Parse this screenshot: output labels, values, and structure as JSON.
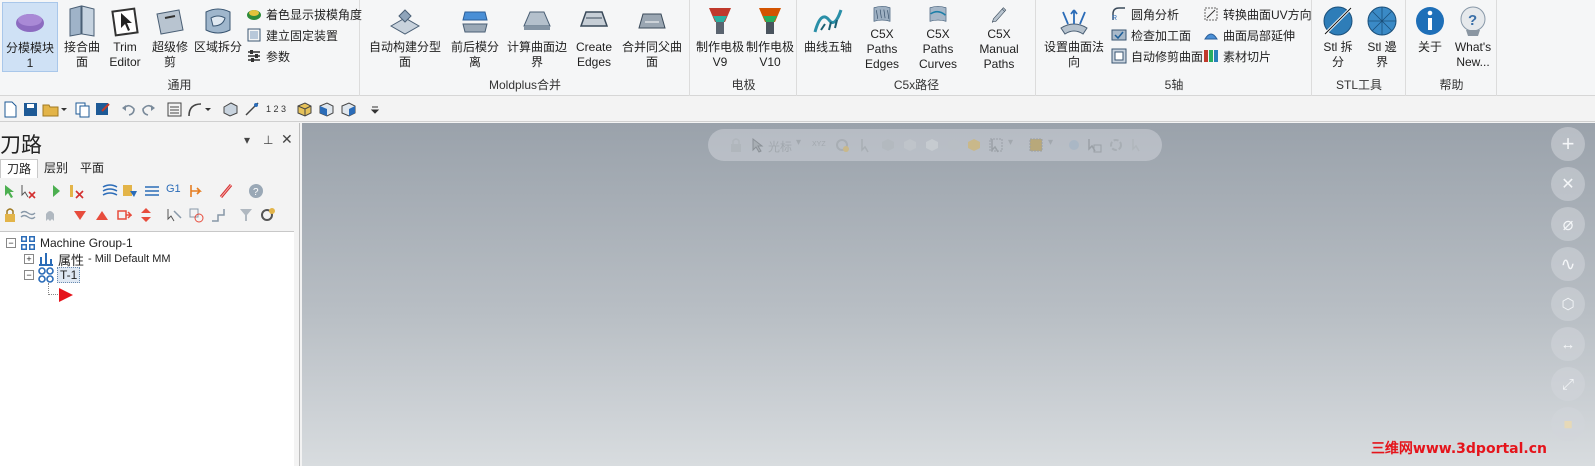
{
  "ribbon": {
    "general": {
      "label": "通用",
      "mold_split_label": "分模模块1",
      "join_surfaces_label": "接合曲面",
      "trim_editor_label": "Trim Editor",
      "super_trim_label": "超级修剪",
      "region_split_label": "区域拆分",
      "color_draft_label": "着色显示拔模角度",
      "fixture_label": "建立固定装置",
      "params_label": "参数"
    },
    "moldplus": {
      "label": "Moldplus合并",
      "auto_parting_label": "自动构建分型面",
      "front_back_split_label": "前后模分离",
      "calc_boundary_label": "计算曲面边界",
      "create_edges_label": "Create Edges",
      "merge_parent_label": "合并同父曲面"
    },
    "electrode": {
      "label": "电极",
      "electrode_v9_label": "制作电极 V9",
      "electrode_v10_label": "制作电极 V10"
    },
    "c5x": {
      "label": "C5x路径",
      "curve_5axis_label": "曲线五轴",
      "paths_edges_label": "C5X Paths Edges",
      "paths_curves_label": "C5X Paths Curves",
      "manual_paths_label": "C5X Manual Paths"
    },
    "five_axis": {
      "label": "5轴",
      "set_normal_label": "设置曲面法向",
      "fillet_analysis_label": "圆角分析",
      "check_machining_label": "检查加工面",
      "auto_trim_label": "自动修剪曲面",
      "convert_uv_label": "转换曲面UV方向",
      "local_extend_label": "曲面局部延伸",
      "material_slice_label": "素材切片"
    },
    "stl": {
      "label": "STL工具",
      "stl_split_label": "Stl 拆分",
      "stl_boundary_label": "Stl 邊界"
    },
    "help": {
      "label": "帮助",
      "about_label": "关于",
      "whats_new_label": "What's New..."
    }
  },
  "qat": {
    "counter_label": "1 2 3"
  },
  "panel": {
    "title": "刀路",
    "tabs": [
      "刀路",
      "层别",
      "平面"
    ],
    "g1_label": "G1",
    "tree": {
      "group": "Machine Group-1",
      "properties_name": "属性",
      "properties_value": "- Mill Default MM",
      "toolpath_group": "T-1"
    }
  },
  "viewport": {
    "cursor_label": "光标",
    "xyz_label": "XYZ",
    "watermark": "三维网www.3dportal.cn"
  },
  "colors": {
    "accent": "#2b6cb8",
    "active_button": "#cfe1f5",
    "watermark": "#e5141b"
  }
}
